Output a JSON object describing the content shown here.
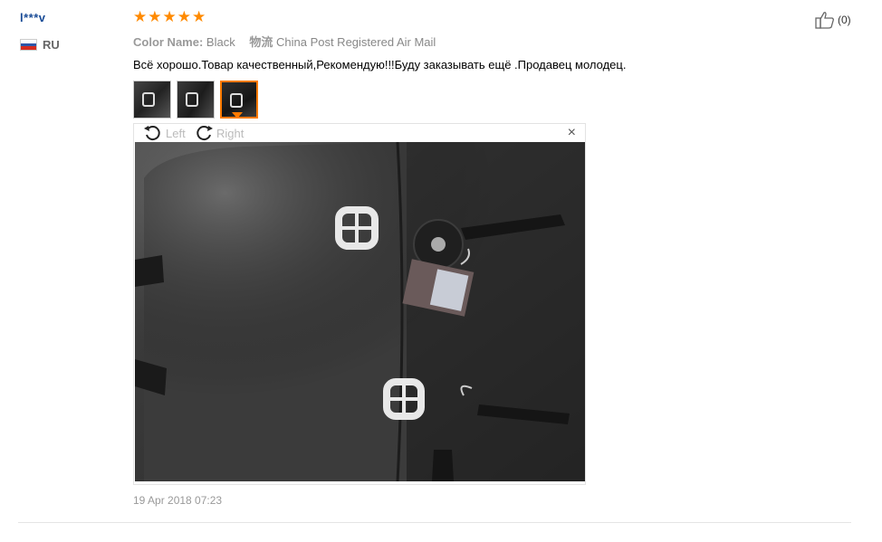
{
  "user": {
    "name": "l***v",
    "country": "RU"
  },
  "review": {
    "rating": 5,
    "color_label": "Color Name:",
    "color_value": "Black",
    "shipping_label": "物流",
    "shipping_value": "China Post Registered Air Mail",
    "text": "Всё хорошо.Товар качественный,Рекомендую!!!Буду заказывать ещё .Продавец молодец.",
    "date": "19 Apr 2018 07:23"
  },
  "viewer": {
    "rotate_left": "Left",
    "rotate_right": "Right",
    "close": "×"
  },
  "helpful": {
    "count": "(0)"
  },
  "colors": {
    "star": "#ff8a00",
    "username": "#1a4c97",
    "active_thumb": "#ff7a00"
  }
}
